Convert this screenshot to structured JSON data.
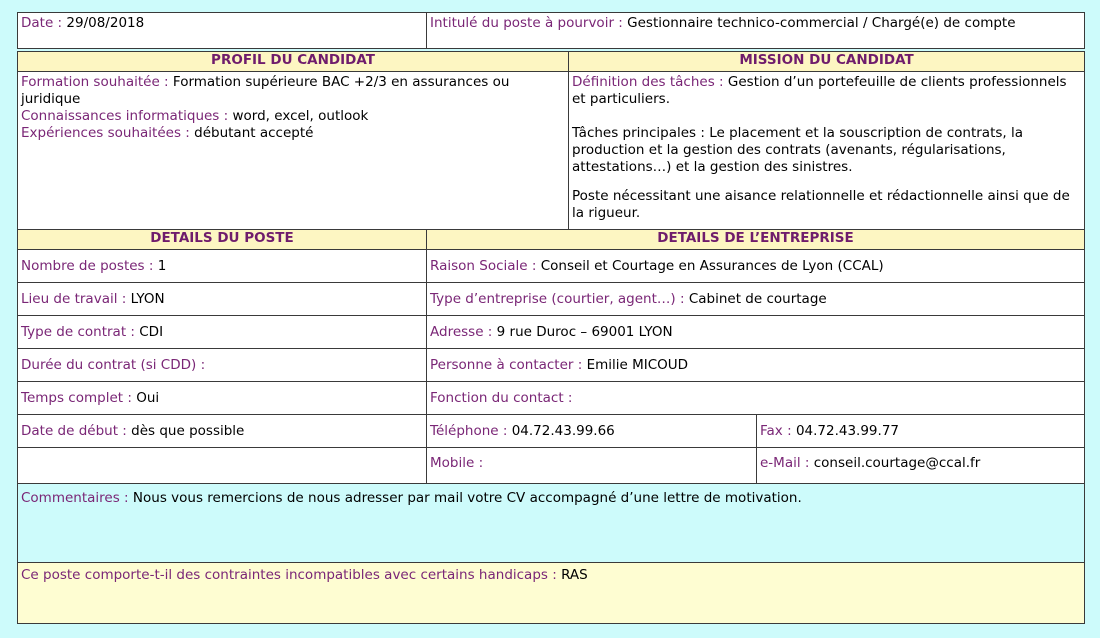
{
  "header": {
    "date_label": "Date :",
    "date_value": "29/08/2018",
    "poste_label": "Intitulé du poste à pourvoir :",
    "poste_value": "Gestionnaire technico-commercial / Chargé(e) de compte"
  },
  "profil": {
    "title": "PROFIL DU CANDIDAT",
    "formation_label": "Formation souhaitée :",
    "formation_value": "Formation supérieure BAC +2/3 en assurances ou juridique",
    "informatique_label": "Connaissances informatiques :",
    "informatique_value": "word, excel, outlook",
    "experiences_label": "Expériences souhaitées :",
    "experiences_value": "débutant accepté"
  },
  "mission": {
    "title": "MISSION DU CANDIDAT",
    "definition_label": "Définition des tâches :",
    "definition_value": "Gestion d’un portefeuille de clients professionnels et particuliers.",
    "taches": "Tâches principales : Le placement et la souscription de contrats, la production et la gestion des contrats (avenants, régularisations, attestations…) et la gestion des sinistres.",
    "poste": "Poste nécessitant une aisance relationnelle et rédactionnelle ainsi que de la rigueur."
  },
  "details_poste": {
    "title": "DETAILS DU POSTE",
    "nombre_label": "Nombre de postes :",
    "nombre_value": "1",
    "lieu_label": "Lieu de travail :",
    "lieu_value": "LYON",
    "type_label": "Type de contrat :",
    "type_value": "CDI",
    "duree_label": "Durée du contrat (si CDD) :",
    "duree_value": "",
    "temps_label": "Temps complet :",
    "temps_value": "Oui",
    "debut_label": "Date de début :",
    "debut_value": "dès que possible"
  },
  "details_entreprise": {
    "title": "DETAILS DE L’ENTREPRISE",
    "raison_label": "Raison Sociale :",
    "raison_value": "Conseil et Courtage en Assurances de Lyon (CCAL)",
    "type_label": "Type d’entreprise (courtier, agent…) :",
    "type_value": "Cabinet de courtage",
    "adresse_label": "Adresse :",
    "adresse_value": "9 rue Duroc – 69001 LYON",
    "personne_label": "Personne à contacter :",
    "personne_value": "Emilie MICOUD",
    "fonction_label": "Fonction du contact :",
    "fonction_value": "",
    "tel_label": "Téléphone :",
    "tel_value": "04.72.43.99.66",
    "fax_label": "Fax :",
    "fax_value": "04.72.43.99.77",
    "mobile_label": "Mobile :",
    "mobile_value": "",
    "email_label": "e-Mail :",
    "email_value": "conseil.courtage@ccal.fr"
  },
  "footer": {
    "commentaires_label": "Commentaires :",
    "commentaires_value": "Nous vous remercions de nous adresser par mail votre CV accompagné d’une lettre de motivation.",
    "handicap_label": "Ce poste comporte-t-il des contraintes incompatibles avec certains handicaps :",
    "handicap_value": "RAS"
  }
}
